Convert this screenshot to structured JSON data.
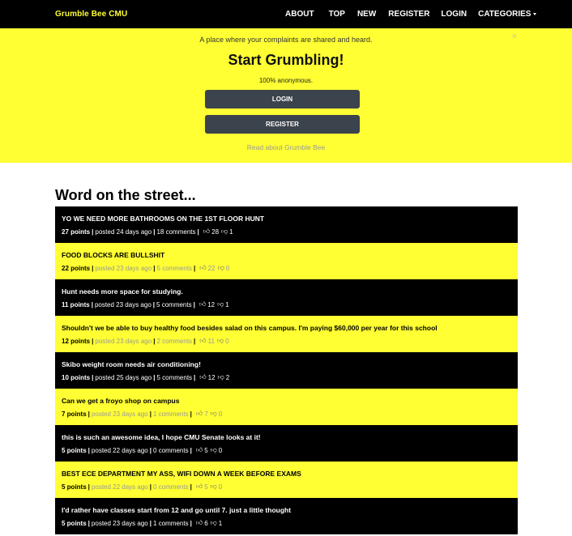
{
  "nav": {
    "brand": "Grumble Bee CMU",
    "links": [
      "ABOUT",
      "TOP",
      "NEW",
      "REGISTER",
      "LOGIN",
      "CATEGORIES"
    ]
  },
  "hero": {
    "tagline": "A place where your complaints are shared and heard.",
    "close": "×",
    "headline": "Start Grumbling!",
    "anon": "100% anonymous.",
    "login": "LOGIN",
    "register": "REGISTER",
    "read_link": "Read about Grumble Bee"
  },
  "feed": {
    "title": "Word on the street...",
    "items": [
      {
        "title": "YO WE NEED MORE BATHROOMS ON THE 1ST FLOOR HUNT",
        "points": "27 points",
        "time": "posted 24 days ago",
        "comments": "18 comments",
        "up": "28",
        "down": "1"
      },
      {
        "title": "FOOD BLOCKS ARE BULLSHIT",
        "points": "22 points",
        "time": "posted 23 days ago",
        "comments": "5 comments",
        "up": "22",
        "down": "0"
      },
      {
        "title": "Hunt needs more space for studying.",
        "points": "11 points",
        "time": "posted 23 days ago",
        "comments": "5 comments",
        "up": "12",
        "down": "1"
      },
      {
        "title": "Shouldn't we be able to buy healthy food besides salad on this campus. I'm paying $60,000 per year for this school",
        "points": "12 points",
        "time": "posted 23 days ago",
        "comments": "2 comments",
        "up": "11",
        "down": "0"
      },
      {
        "title": "Skibo weight room needs air conditioning!",
        "points": "10 points",
        "time": "posted 25 days ago",
        "comments": "5 comments",
        "up": "12",
        "down": "2"
      },
      {
        "title": "Can we get a froyo shop on campus",
        "points": "7 points",
        "time": "posted 23 days ago",
        "comments": "1 comments",
        "up": "7",
        "down": "0"
      },
      {
        "title": "this is such an awesome idea, I hope CMU Senate looks at it!",
        "points": "5 points",
        "time": "posted 22 days ago",
        "comments": "0 comments",
        "up": "5",
        "down": "0"
      },
      {
        "title": "BEST ECE DEPARTMENT MY ASS, WIFI DOWN A WEEK BEFORE EXAMS",
        "points": "5 points",
        "time": "posted 22 days ago",
        "comments": "0 comments",
        "up": "5",
        "down": "0"
      },
      {
        "title": "I'd rather have classes start from 12 and go until 7. just a little thought",
        "points": "5 points",
        "time": "posted 23 days ago",
        "comments": "1 comments",
        "up": "6",
        "down": "1"
      }
    ]
  }
}
